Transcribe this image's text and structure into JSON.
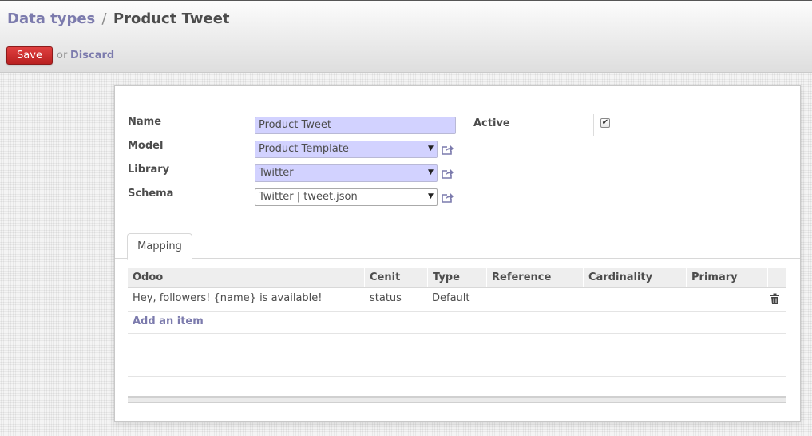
{
  "breadcrumb": {
    "parent": "Data types",
    "separator": "/",
    "current": "Product Tweet"
  },
  "buttons": {
    "save": "Save",
    "or": "or",
    "discard": "Discard"
  },
  "form": {
    "name_label": "Name",
    "name_value": "Product Tweet",
    "model_label": "Model",
    "model_value": "Product Template",
    "library_label": "Library",
    "library_value": "Twitter",
    "schema_label": "Schema",
    "schema_value": "Twitter | tweet.json",
    "active_label": "Active",
    "active_checked": true,
    "dropdown_icon": "caret-down-icon",
    "open_icon": "external-link-icon"
  },
  "tabs": [
    {
      "label": "Mapping",
      "active": true
    }
  ],
  "table": {
    "columns": [
      "Odoo",
      "Cenit",
      "Type",
      "Reference",
      "Cardinality",
      "Primary"
    ],
    "rows": [
      {
        "odoo": "Hey, followers! {name} is available!",
        "cenit": "status",
        "type": "Default",
        "reference": "",
        "cardinality": "",
        "primary": ""
      }
    ],
    "add_item": "Add an item",
    "delete_icon": "trash-icon"
  },
  "colors": {
    "accent": "#7c7bad",
    "save_button": "#c9302c",
    "required_field": "#d2d2ff"
  }
}
